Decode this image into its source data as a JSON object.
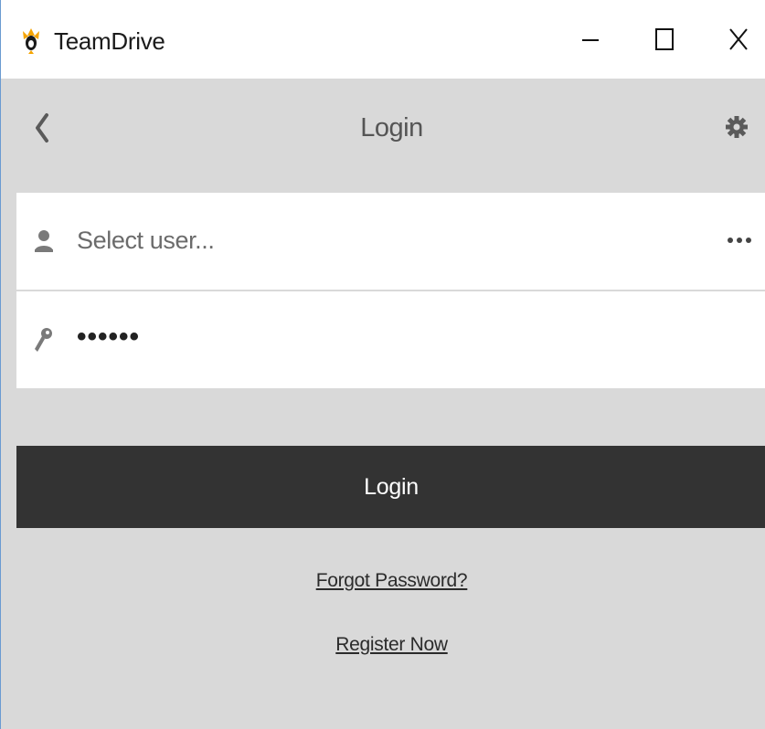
{
  "window": {
    "title": "TeamDrive",
    "icon": "teamdrive-logo"
  },
  "header": {
    "title": "Login",
    "back_icon": "chevron-left-icon",
    "settings_icon": "gear-icon"
  },
  "form": {
    "user": {
      "placeholder": "Select user...",
      "icon": "user-icon",
      "more_icon": "ellipsis-icon"
    },
    "password": {
      "value": "••••••",
      "icon": "key-icon"
    }
  },
  "actions": {
    "login_label": "Login",
    "forgot_label": "Forgot Password?",
    "register_label": "Register Now"
  },
  "colors": {
    "background": "#d9d9d9",
    "button_bg": "#333333",
    "logo_accent": "#f5a400"
  }
}
